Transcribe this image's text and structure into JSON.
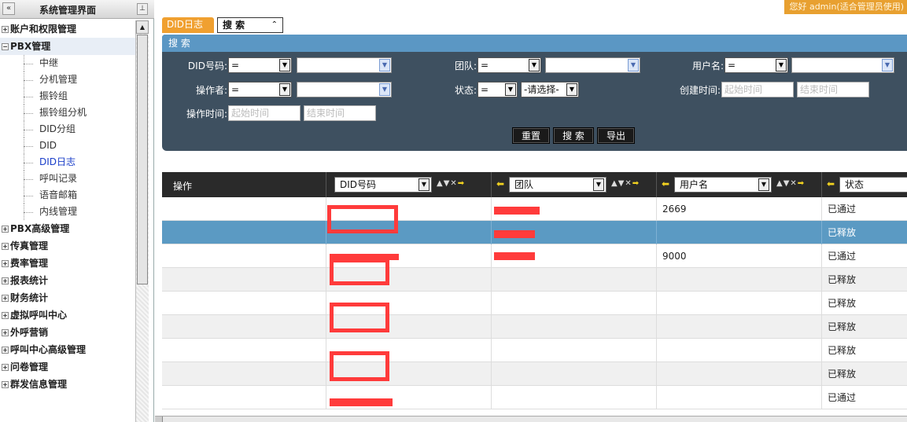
{
  "sidebar": {
    "title": "系统管理界面",
    "collapse_icon": "«",
    "pin_icon": "⊥",
    "groups": [
      {
        "label": "账户和权限管理",
        "expanded": false
      },
      {
        "label": "PBX管理",
        "expanded": true
      },
      {
        "label": "PBX高级管理",
        "expanded": false
      },
      {
        "label": "传真管理",
        "expanded": false
      },
      {
        "label": "费率管理",
        "expanded": false
      },
      {
        "label": "报表统计",
        "expanded": false
      },
      {
        "label": "财务统计",
        "expanded": false
      },
      {
        "label": "虚拟呼叫中心",
        "expanded": false
      },
      {
        "label": "外呼营销",
        "expanded": false
      },
      {
        "label": "呼叫中心高级管理",
        "expanded": false
      },
      {
        "label": "问卷管理",
        "expanded": false
      },
      {
        "label": "群发信息管理",
        "expanded": false
      }
    ],
    "pbx_children": [
      "中继",
      "分机管理",
      "振铃组",
      "振铃组分机",
      "DID分组",
      "DID",
      "DID日志",
      "呼叫记录",
      "语音邮箱",
      "内线管理"
    ],
    "active_child": "DID日志"
  },
  "topbar": {
    "user_info": "您好 admin(适合管理员使用)"
  },
  "tabs": {
    "did_log": "DID日志",
    "search": "搜 索",
    "search_toggle_icon": "≈"
  },
  "search_panel": {
    "title": "搜 索",
    "labels": {
      "did": "DID号码:",
      "team": "团队:",
      "username": "用户名:",
      "operator": "操作者:",
      "status": "状态:",
      "created": "创建时间:",
      "op_time": "操作时间:"
    },
    "operator_value": "=",
    "status_select": "-请选择-",
    "date_from": "起始时间",
    "date_to": "结束时间",
    "buttons": {
      "reset": "重置",
      "search": "搜 索",
      "export": "导出"
    }
  },
  "grid": {
    "col_action": "操作",
    "col_did": "DID号码",
    "col_team": "团队",
    "col_user": "用户名",
    "col_status": "状态",
    "tools": "▲▼✕",
    "rows": [
      {
        "user": "2669",
        "status": "已通过",
        "selected": false
      },
      {
        "user": "",
        "status": "已释放",
        "selected": true
      },
      {
        "user": "9000",
        "status": "已通过",
        "selected": false
      },
      {
        "user": "",
        "status": "已释放",
        "selected": false
      },
      {
        "user": "",
        "status": "已释放",
        "selected": false
      },
      {
        "user": "",
        "status": "已释放",
        "selected": false
      },
      {
        "user": "",
        "status": "已释放",
        "selected": false
      },
      {
        "user": "",
        "status": "已释放",
        "selected": false
      },
      {
        "user": "",
        "status": "已通过",
        "selected": false
      }
    ]
  }
}
